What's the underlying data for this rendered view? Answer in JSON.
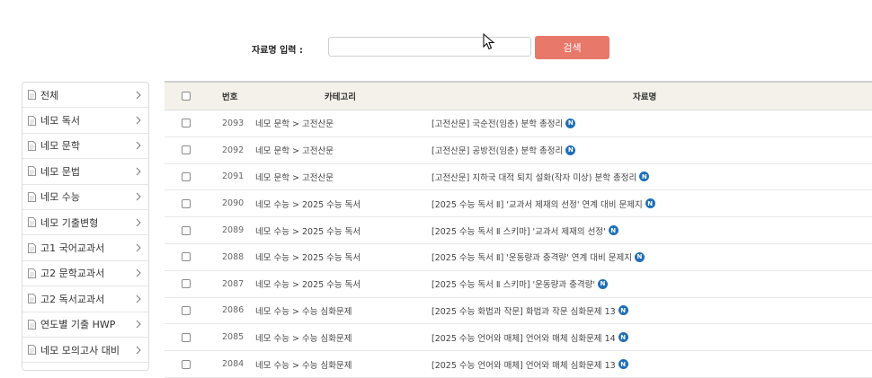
{
  "search": {
    "label": "자료명 입력 :",
    "placeholder": "",
    "button_label": "검색"
  },
  "sidebar": {
    "items": [
      {
        "label": "전체"
      },
      {
        "label": "네모 독서"
      },
      {
        "label": "네모 문학"
      },
      {
        "label": "네모 문법"
      },
      {
        "label": "네모 수능"
      },
      {
        "label": "네모 기출변형"
      },
      {
        "label": "고1 국어교과서"
      },
      {
        "label": "고2 문학교과서"
      },
      {
        "label": "고2 독서교과서"
      },
      {
        "label": "연도별 기출 HWP"
      },
      {
        "label": "네모 모의고사 대비"
      }
    ]
  },
  "table": {
    "headers": {
      "num": "번호",
      "category": "카테고리",
      "title": "자료명"
    },
    "badge_text": "N",
    "rows": [
      {
        "num": "2093",
        "category": "네모 문학 > 고전산문",
        "title": "[고전산문] 국순전(임춘) 분학 총정리"
      },
      {
        "num": "2092",
        "category": "네모 문학 > 고전산문",
        "title": "[고전산문] 공방전(임춘) 분학 총정리"
      },
      {
        "num": "2091",
        "category": "네모 문학 > 고전산문",
        "title": "[고전산문] 지하국 대적 퇴치 설화(작자 미상) 분학 총정리"
      },
      {
        "num": "2090",
        "category": "네모 수능 > 2025 수능 독서",
        "title": "[2025 수능 독서 Ⅱ] '교과서 제재의 선정' 연계 대비 문제지"
      },
      {
        "num": "2089",
        "category": "네모 수능 > 2025 수능 독서",
        "title": "[2025 수능 독서 Ⅱ 스키마] '교과서 제재의 선정'"
      },
      {
        "num": "2088",
        "category": "네모 수능 > 2025 수능 독서",
        "title": "[2025 수능 독서 Ⅱ] '운동량과 충격량' 연계 대비 문제지"
      },
      {
        "num": "2087",
        "category": "네모 수능 > 2025 수능 독서",
        "title": "[2025 수능 독서 Ⅱ 스키마] '운동량과 충격량'"
      },
      {
        "num": "2086",
        "category": "네모 수능 > 수능 심화문제",
        "title": "[2025 수능 화법과 작문] 화법과 작문 심화문제 13"
      },
      {
        "num": "2085",
        "category": "네모 수능 > 수능 심화문제",
        "title": "[2025 수능 언어와 매체] 언어와 매체 심화문제 14"
      },
      {
        "num": "2084",
        "category": "네모 수능 > 수능 심화문제",
        "title": "[2025 수능 언어와 매체] 언어와 매체 심화문제 13"
      }
    ]
  }
}
